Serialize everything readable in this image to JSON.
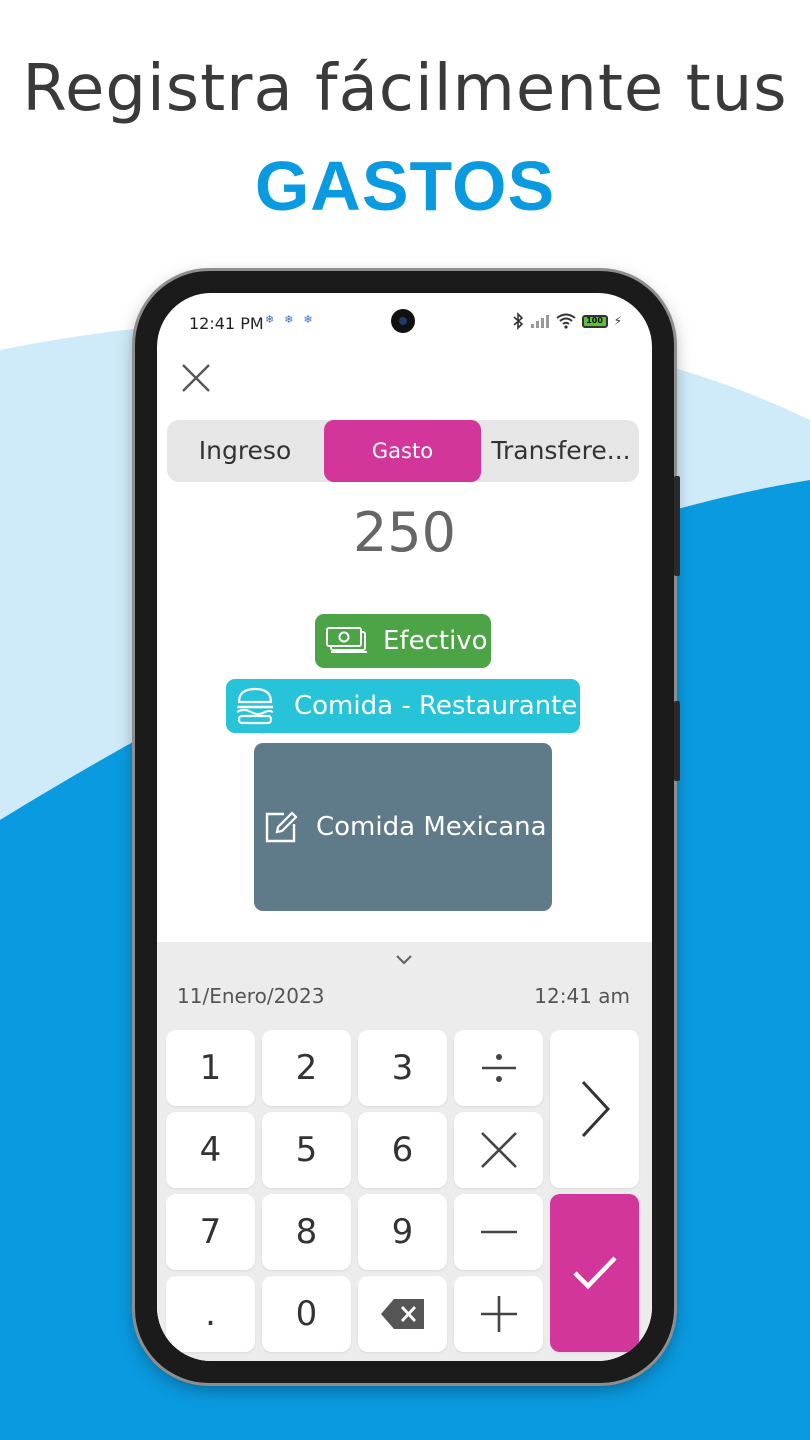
{
  "headline": {
    "line1": "Registra fácilmente tus",
    "line2": "GASTOS"
  },
  "colors": {
    "accent_blue": "#0a9ae0",
    "pink": "#d2369a",
    "green": "#4ca447",
    "cyan": "#27c3d8",
    "slate": "#5f7a88"
  },
  "status_bar": {
    "time": "12:41 PM",
    "battery": "100"
  },
  "tabs": [
    {
      "label": "Ingreso",
      "active": false
    },
    {
      "label": "Gasto",
      "active": true
    },
    {
      "label": "Transfere...",
      "active": false
    }
  ],
  "amount": "250",
  "account": {
    "label": "Efectivo",
    "icon": "cash-icon"
  },
  "category": {
    "label": "Comida - Restaurante",
    "icon": "burger-icon"
  },
  "note": {
    "label": "Comida Mexicana",
    "icon": "edit-note-icon"
  },
  "keypad": {
    "date": "11/Enero/2023",
    "time": "12:41 am",
    "keys": {
      "k1": "1",
      "k2": "2",
      "k3": "3",
      "k4": "4",
      "k5": "5",
      "k6": "6",
      "k7": "7",
      "k8": "8",
      "k9": "9",
      "dot": ".",
      "k0": "0"
    },
    "icons": [
      "divide-icon",
      "multiply-icon",
      "minus-icon",
      "plus-icon",
      "backspace-icon",
      "next-icon",
      "check-icon"
    ]
  }
}
